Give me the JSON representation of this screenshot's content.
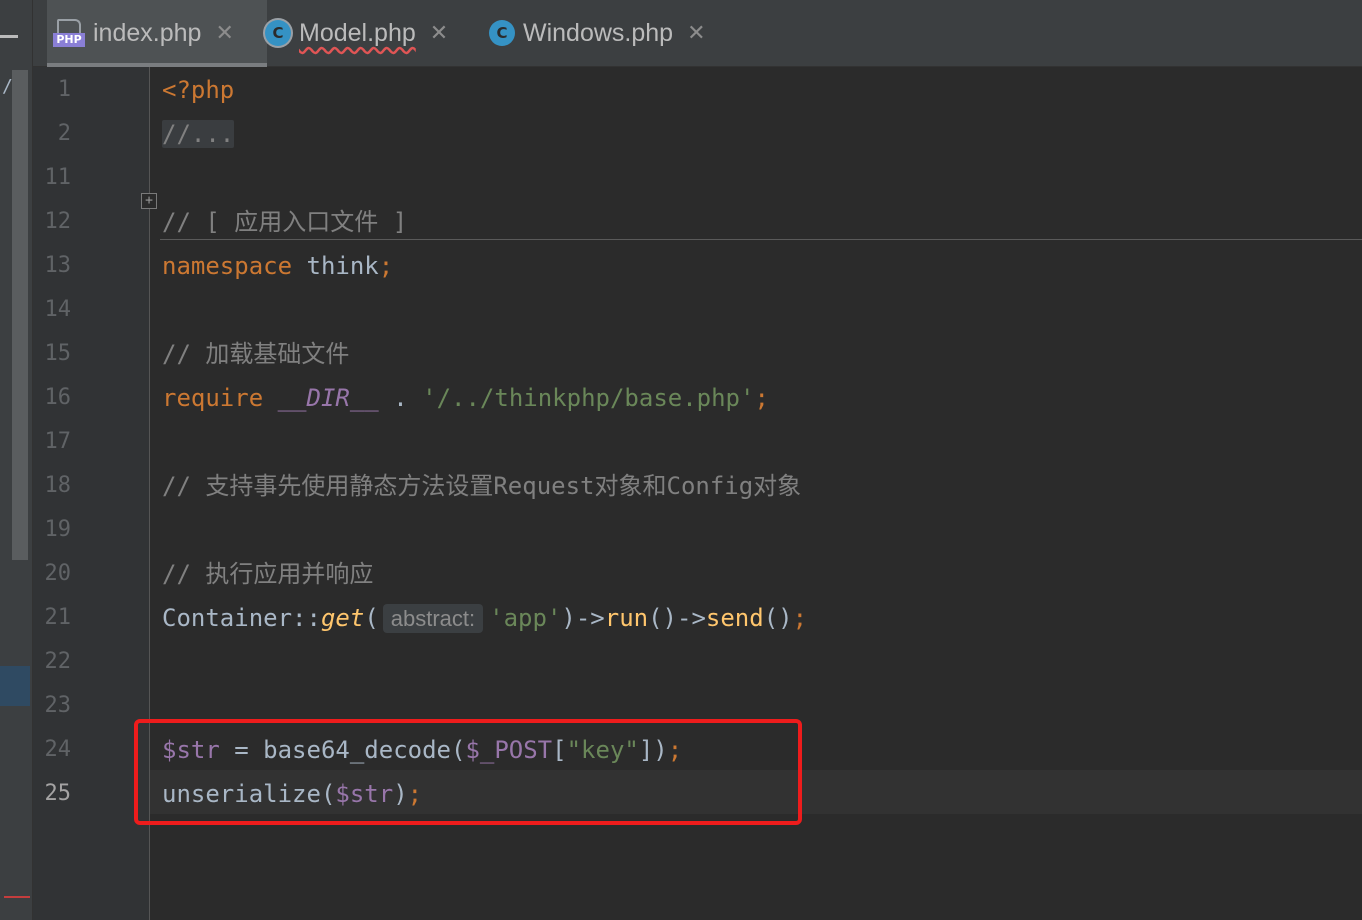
{
  "tabs": [
    {
      "label": "index.php",
      "icon": "php-file-icon",
      "active": true,
      "error": false
    },
    {
      "label": "Model.php",
      "icon": "class-icon",
      "active": false,
      "error": true
    },
    {
      "label": "Windows.php",
      "icon": "class-icon",
      "active": false,
      "error": false
    }
  ],
  "tab_close_glyph": "✕",
  "icon_badge_text": "PHP",
  "icon_class_letter": "C",
  "left_strip_text": "/",
  "fold_glyph": "+",
  "colors": {
    "keyword": "#cc7832",
    "string": "#6a8759",
    "comment": "#808080",
    "variable": "#9876aa",
    "function": "#ffc66d",
    "default": "#a9b7c6",
    "highlight_box": "#ee1c1c"
  },
  "lines": [
    {
      "num": "1",
      "tokens": [
        {
          "t": "<?php",
          "c": "keyword"
        }
      ]
    },
    {
      "num": "2",
      "tokens": [
        {
          "t": "//...",
          "c": "fold"
        }
      ]
    },
    {
      "num": "11",
      "tokens": []
    },
    {
      "num": "12",
      "tokens": [
        {
          "t": "// [ 应用入口文件 ]",
          "c": "comment"
        }
      ]
    },
    {
      "num": "13",
      "tokens": [
        {
          "t": "namespace",
          "c": "keyword"
        },
        {
          "t": " think",
          "c": "default"
        },
        {
          "t": ";",
          "c": "keyword"
        }
      ]
    },
    {
      "num": "14",
      "tokens": []
    },
    {
      "num": "15",
      "tokens": [
        {
          "t": "// 加载基础文件",
          "c": "comment"
        }
      ]
    },
    {
      "num": "16",
      "tokens": [
        {
          "t": "require",
          "c": "keyword"
        },
        {
          "t": " ",
          "c": "default"
        },
        {
          "t": "__DIR__",
          "c": "variable-italic"
        },
        {
          "t": " . ",
          "c": "default"
        },
        {
          "t": "'/../thinkphp/base.php'",
          "c": "string"
        },
        {
          "t": ";",
          "c": "keyword"
        }
      ]
    },
    {
      "num": "17",
      "tokens": []
    },
    {
      "num": "18",
      "tokens": [
        {
          "t": "// 支持事先使用静态方法设置Request对象和Config对象",
          "c": "comment"
        }
      ]
    },
    {
      "num": "19",
      "tokens": []
    },
    {
      "num": "20",
      "tokens": [
        {
          "t": "// 执行应用并响应",
          "c": "comment"
        }
      ]
    },
    {
      "num": "21",
      "tokens": [
        {
          "t": "Container",
          "c": "default"
        },
        {
          "t": "::",
          "c": "default"
        },
        {
          "t": "get",
          "c": "function-italic"
        },
        {
          "t": "(",
          "c": "default"
        },
        {
          "t": "abstract:",
          "c": "hint"
        },
        {
          "t": "'app'",
          "c": "string"
        },
        {
          "t": ")->",
          "c": "default"
        },
        {
          "t": "run",
          "c": "function"
        },
        {
          "t": "()->",
          "c": "default"
        },
        {
          "t": "send",
          "c": "function"
        },
        {
          "t": "()",
          "c": "default"
        },
        {
          "t": ";",
          "c": "keyword"
        }
      ]
    },
    {
      "num": "22",
      "tokens": []
    },
    {
      "num": "23",
      "tokens": []
    },
    {
      "num": "24",
      "tokens": [
        {
          "t": "$str",
          "c": "variable"
        },
        {
          "t": " = base64_decode(",
          "c": "default"
        },
        {
          "t": "$_POST",
          "c": "variable"
        },
        {
          "t": "[",
          "c": "default"
        },
        {
          "t": "\"key\"",
          "c": "string"
        },
        {
          "t": "])",
          "c": "default"
        },
        {
          "t": ";",
          "c": "keyword"
        }
      ]
    },
    {
      "num": "25",
      "tokens": [
        {
          "t": "unserialize(",
          "c": "default"
        },
        {
          "t": "$str",
          "c": "variable"
        },
        {
          "t": ")",
          "c": "default"
        },
        {
          "t": ";",
          "c": "keyword"
        }
      ],
      "current": true
    }
  ]
}
